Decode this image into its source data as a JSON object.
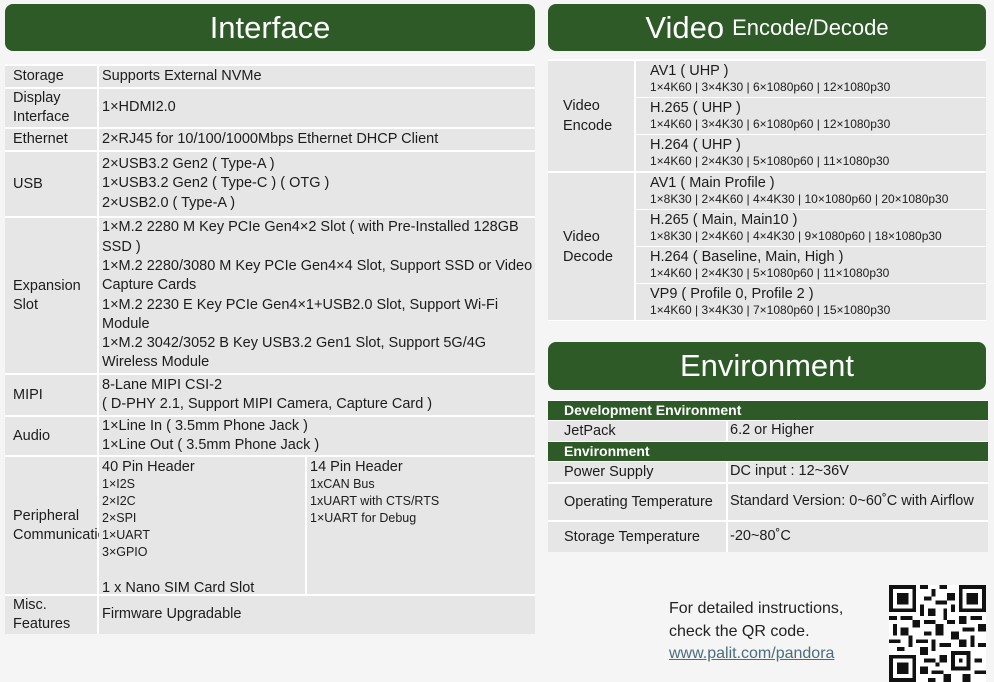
{
  "interface": {
    "title": "Interface",
    "rows": {
      "storage": {
        "label": "Storage",
        "value": "Supports External NVMe"
      },
      "display": {
        "label": "Display Interface",
        "value": "1×HDMI2.0"
      },
      "ethernet": {
        "label": "Ethernet",
        "value": "2×RJ45 for 10/100/1000Mbps Ethernet DHCP Client"
      },
      "usb": {
        "label": "USB",
        "lines": [
          "2×USB3.2 Gen2 ( Type-A )",
          "1×USB3.2 Gen2 ( Type-C ) ( OTG )",
          "2×USB2.0 ( Type-A )"
        ]
      },
      "expansion": {
        "label": "Expansion Slot",
        "lines": [
          "1×M.2 2280 M Key PCIe Gen4×2 Slot ( with Pre-Installed 128GB SSD )",
          "1×M.2 2280/3080 M Key PCIe Gen4×4 Slot, Support SSD or Video Capture Cards",
          "1×M.2 2230 E Key PCIe Gen4×1+USB2.0 Slot, Support Wi-Fi Module",
          "1×M.2 3042/3052 B Key USB3.2 Gen1 Slot, Support 5G/4G Wireless Module"
        ]
      },
      "mipi": {
        "label": "MIPI",
        "lines": [
          "8-Lane MIPI CSI-2",
          "( D-PHY 2.1, Support MIPI Camera, Capture Card )"
        ]
      },
      "audio": {
        "label": "Audio",
        "lines": [
          "1×Line In ( 3.5mm Phone Jack )",
          "1×Line Out ( 3.5mm Phone Jack )"
        ]
      },
      "peripheral": {
        "label": "Peripheral Communication",
        "header40": "40 Pin Header",
        "items40": [
          "1×I2S",
          "2×I2C",
          "2×SPI",
          "1×UART",
          "3×GPIO"
        ],
        "sim": "1 x Nano SIM Card Slot",
        "header14": "14 Pin Header",
        "items14": [
          "1xCAN Bus",
          "1xUART with CTS/RTS",
          "1×UART for Debug"
        ]
      },
      "misc": {
        "label": "Misc. Features",
        "value": "Firmware Upgradable"
      }
    }
  },
  "video": {
    "title_main": "Video",
    "title_sub": "Encode/Decode",
    "encode": {
      "label": "Video Encode",
      "codecs": [
        {
          "name": "AV1 ( UHP )",
          "spec": "1×4K60 | 3×4K30 | 6×1080p60 | 12×1080p30"
        },
        {
          "name": "H.265 ( UHP )",
          "spec": "1×4K60 | 3×4K30 | 6×1080p60 | 12×1080p30"
        },
        {
          "name": "H.264 ( UHP )",
          "spec": "1×4K60 | 2×4K30 | 5×1080p60 | 11×1080p30"
        }
      ]
    },
    "decode": {
      "label": "Video Decode",
      "codecs": [
        {
          "name": "AV1 ( Main Profile )",
          "spec": "1×8K30 | 2×4K60 | 4×4K30 | 10×1080p60 | 20×1080p30"
        },
        {
          "name": "H.265 ( Main, Main10 )",
          "spec": "1×8K30 | 2×4K60 | 4×4K30 | 9×1080p60 | 18×1080p30"
        },
        {
          "name": "H.264 ( Baseline, Main, High )",
          "spec": "1×4K60 | 2×4K30 | 5×1080p60 | 11×1080p30"
        },
        {
          "name": "VP9 ( Profile 0, Profile 2 )",
          "spec": "1×4K60 | 3×4K30 | 7×1080p60 | 15×1080p30"
        }
      ]
    }
  },
  "environment": {
    "title": "Environment",
    "dev_header": "Development Environment",
    "jetpack": {
      "key": "JetPack",
      "value": "6.2 or Higher"
    },
    "env_header": "Environment",
    "power": {
      "key": "Power Supply",
      "value": "DC input : 12~36V"
    },
    "op_temp": {
      "key": "Operating Temperature",
      "value": "Standard Version: 0~60˚C with Airflow"
    },
    "storage_temp": {
      "key": "Storage Temperature",
      "value": "-20~80˚C"
    }
  },
  "footer": {
    "note_line1": "For detailed instructions,",
    "note_line2": "check the QR code.",
    "link": "www.palit.com/pandora"
  },
  "colors": {
    "brand_green": "#2d5a27",
    "cell_gray": "#e6e6e6"
  }
}
